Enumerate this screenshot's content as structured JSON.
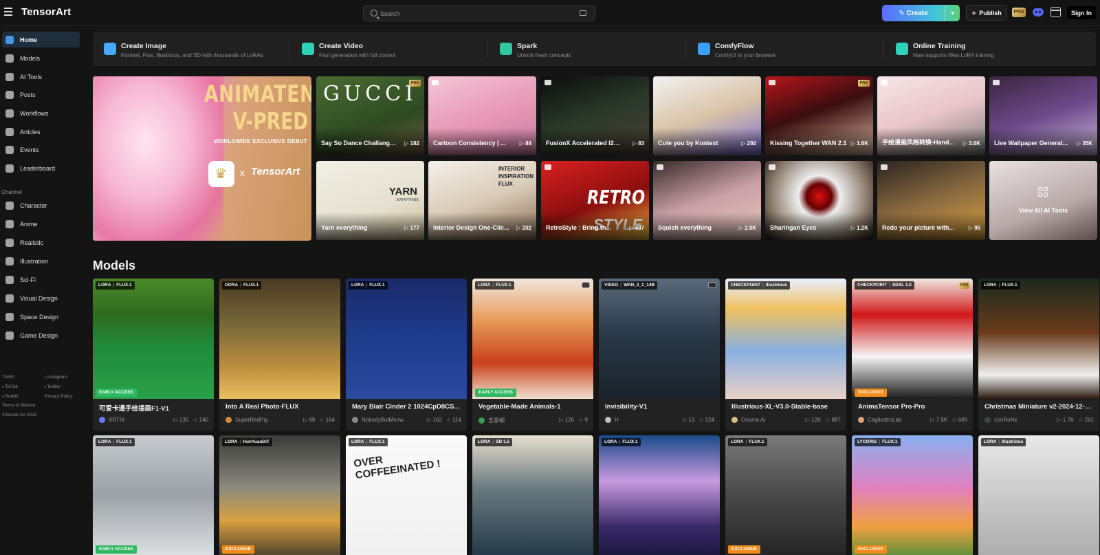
{
  "header": {
    "logo": "TensorArt",
    "search_placeholder": "Search",
    "create_label": "Create",
    "publish_label": "Publish",
    "pro_label": "PRO",
    "signin_label": "Sign In"
  },
  "sidebar": {
    "items": [
      {
        "label": "Home",
        "icon": "home-icon"
      },
      {
        "label": "Models",
        "icon": "models-icon"
      },
      {
        "label": "AI Tools",
        "icon": "ai-tools-icon"
      },
      {
        "label": "Posts",
        "icon": "posts-icon"
      },
      {
        "label": "Workflows",
        "icon": "workflows-icon"
      },
      {
        "label": "Articles",
        "icon": "articles-icon"
      },
      {
        "label": "Events",
        "icon": "events-icon"
      },
      {
        "label": "Leaderboard",
        "icon": "trophy-icon"
      }
    ],
    "channel_label": "Channel",
    "channels": [
      {
        "label": "Character"
      },
      {
        "label": "Anime"
      },
      {
        "label": "Realistic"
      },
      {
        "label": "Illustration"
      },
      {
        "label": "Sci-Fi"
      },
      {
        "label": "Visual Design"
      },
      {
        "label": "Space Design"
      },
      {
        "label": "Game Design"
      }
    ],
    "footer": {
      "tams": "TAMS",
      "instagram": "Instagram",
      "tiktok": "TikTok",
      "twitter": "Twitter",
      "reddit": "Reddit",
      "privacy": "Privacy Policy",
      "terms": "Terms of Service",
      "copyright": "©Tensor.Art 2025"
    }
  },
  "quickbar": [
    {
      "title": "Create Image",
      "sub": "Kontext, Flux, Illustrious, and SD with thousands of LoRAs",
      "color": "#4aa9ff"
    },
    {
      "title": "Create Video",
      "sub": "Fast generation with full control",
      "color": "#2ed3b7"
    },
    {
      "title": "Spark",
      "sub": "Unlock fresh concepts",
      "color": "#2ec7a0"
    },
    {
      "title": "ComfyFlow",
      "sub": "ComfyUI in your browser",
      "color": "#3aa0ff"
    },
    {
      "title": "Online Training",
      "sub": "Now supports Wan LoRA training",
      "color": "#2ed3b7"
    }
  ],
  "banner": {
    "line1": "ANIMATENSOR",
    "line2": "V-PRED",
    "line3": "WORLDWIDE EXCLUSIVE DEBUT",
    "x": "x",
    "brand": "TensorArt"
  },
  "tools": [
    {
      "title": "Say So Dance Challange ...",
      "count": "182",
      "pro": true
    },
    {
      "title": "Cartoon Consistency | ...",
      "count": "84"
    },
    {
      "title": "FusionX Accelerated I2V:...",
      "count": "83"
    },
    {
      "title": "Cute you by Kontext",
      "count": "292"
    },
    {
      "title": "Kissing Together WAN 2.1",
      "count": "1.6K",
      "pro": true
    },
    {
      "title": "手绘漫画风格转换-Hand...",
      "count": "3.6K"
    },
    {
      "title": "Live Wallpaper Generat...",
      "count": "35K"
    },
    {
      "title": "Yarn everything",
      "count": "177"
    },
    {
      "title": "Interior Design One-Clic...",
      "count": "202"
    },
    {
      "title": "RetroStyle : Bring th...",
      "count": "497"
    },
    {
      "title": "Squish everything",
      "count": "2.9K"
    },
    {
      "title": "Sharingan Eyes",
      "count": "1.2K"
    },
    {
      "title": "Redo your picture with...",
      "count": "95"
    }
  ],
  "tool_texts": {
    "gucci": "GUCCI",
    "pro": "PRO",
    "yarn": "YARN",
    "yarn_sub": "EVERYTHING",
    "interior": "INTERIOR",
    "interior2": "INSPIRATION",
    "interior3": "FLUX",
    "retro": "RETRO",
    "style": "STYLE",
    "view_all": "View All AI Tools"
  },
  "models_title": "Models",
  "models": [
    {
      "type": "LORA",
      "base": "FLUX.1",
      "title": "可爱卡通手绘插画F1-V1",
      "author": "ARTIX",
      "runs": "135",
      "stars": "140",
      "badge": "EARLY ACCESS"
    },
    {
      "type": "DORA",
      "base": "FLUX.1",
      "title": "Into A Real Photo-FLUX",
      "author": "SuperRedPig",
      "runs": "99",
      "stars": "164"
    },
    {
      "type": "LORA",
      "base": "FLUX.1",
      "title": "Mary Blair Cinder 2 1024CpD8CS...",
      "author": "NobodyButMeow",
      "runs": "162",
      "stars": "114"
    },
    {
      "type": "LORA",
      "base": "FLUX.1",
      "title": "Vegetable-Made Animals-1",
      "author": "五廖细",
      "runs": "126",
      "stars": "9",
      "badge": "EARLY ACCESS"
    },
    {
      "type": "VIDEO",
      "base": "WAN_2_1_14B",
      "title": "Invisibility-V1",
      "author": "H",
      "runs": "13",
      "stars": "124"
    },
    {
      "type": "CHECKPOINT",
      "base": "Illustrious",
      "title": "Illustrious-XL-V3.0-Stable-base",
      "author": "Onoma AI",
      "runs": "12K",
      "stars": "887"
    },
    {
      "type": "CHECKPOINT",
      "base": "SDXL 1.0",
      "title": "AnimaTensor Pro-Pro",
      "author": "CagliostroLab",
      "runs": "7.5K",
      "stars": "609",
      "badge": "EXCLUSIVE",
      "pro": true
    },
    {
      "type": "LORA",
      "base": "FLUX.1",
      "title": "Christmas Miniature v2-2024-12-01...",
      "author": "xVoRoNx",
      "runs": "1.7K",
      "stars": "261"
    }
  ],
  "models_row2": [
    {
      "type": "LORA",
      "base": "FLUX.1",
      "badge": "EARLY ACCESS"
    },
    {
      "type": "LORA",
      "base": "HunYuanDiT",
      "badge": "EXCLUSIVE"
    },
    {
      "type": "LORA",
      "base": "FLUX.1",
      "text": "OVER COFFEEINATED !"
    },
    {
      "type": "LORA",
      "base": "SD 1.5"
    },
    {
      "type": "LORA",
      "base": "FLUX.1"
    },
    {
      "type": "LORA",
      "base": "FLUX.1",
      "badge": "EXCLUSIVE"
    },
    {
      "type": "LYCORIS",
      "base": "FLUX.1",
      "badge": "EXCLUSIVE"
    },
    {
      "type": "LORA",
      "base": "Illustrious"
    }
  ]
}
